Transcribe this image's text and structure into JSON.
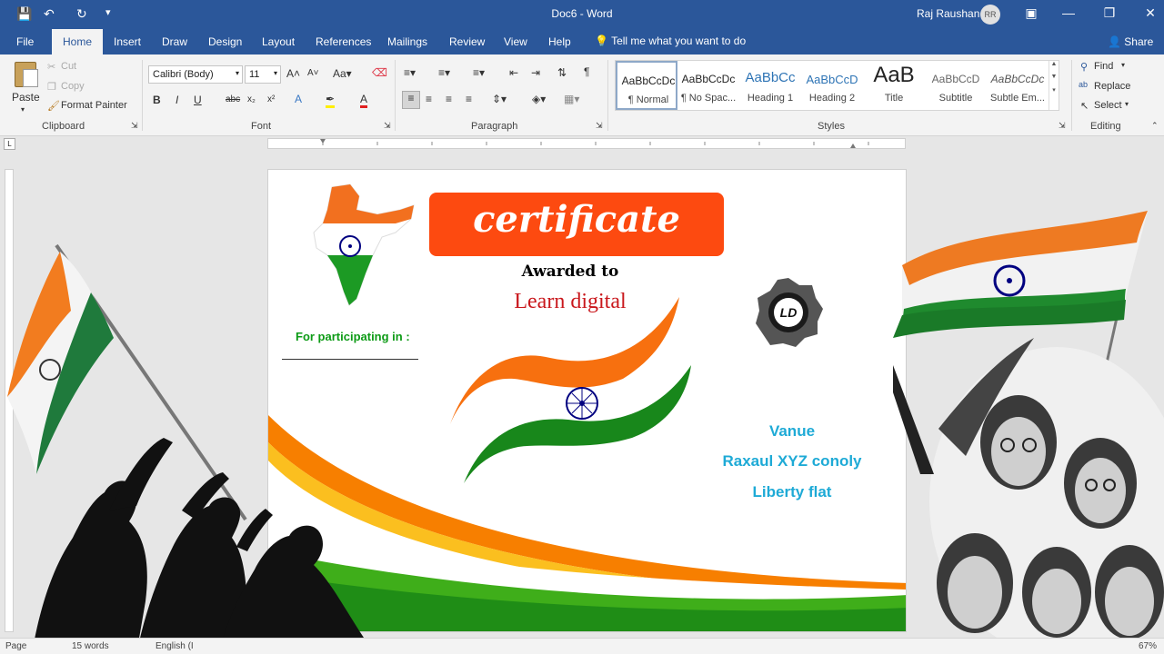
{
  "window": {
    "title": "Doc6  -  Word",
    "user_name": "Raj Raushan",
    "user_initials": "RR"
  },
  "menu_tabs": [
    "File",
    "Home",
    "Insert",
    "Draw",
    "Design",
    "Layout",
    "References",
    "Mailings",
    "Review",
    "View",
    "Help"
  ],
  "active_tab": "Home",
  "tell_me": "Tell me what you want to do",
  "share_label": "Share",
  "clipboard": {
    "paste": "Paste",
    "cut": "Cut",
    "copy": "Copy",
    "format_painter": "Format Painter",
    "group_label": "Clipboard"
  },
  "font": {
    "family": "Calibri (Body)",
    "size": "11",
    "group_label": "Font"
  },
  "paragraph": {
    "group_label": "Paragraph"
  },
  "styles": {
    "group_label": "Styles",
    "items": [
      {
        "sample": "AaBbCcDc",
        "name": "¶ Normal"
      },
      {
        "sample": "AaBbCcDc",
        "name": "¶ No Spac..."
      },
      {
        "sample": "AaBbCc",
        "name": "Heading 1"
      },
      {
        "sample": "AaBbCcD",
        "name": "Heading 2"
      },
      {
        "sample": "AaB",
        "name": "Title"
      },
      {
        "sample": "AaBbCcD",
        "name": "Subtitle"
      },
      {
        "sample": "AaBbCcDc",
        "name": "Subtle Em..."
      }
    ]
  },
  "editing": {
    "find": "Find",
    "replace": "Replace",
    "select": "Select",
    "group_label": "Editing"
  },
  "certificate": {
    "title": "certificate",
    "awarded_to": "Awarded to",
    "recipient": "Learn digital",
    "participating": "For participating in :",
    "venue_lines": [
      "Vanue",
      "Raxaul XYZ conoly",
      "Liberty flat"
    ],
    "logo_text": "LD"
  },
  "status": {
    "page": "Page",
    "words": "15 words",
    "language": "English (I",
    "zoom": "67%"
  },
  "colors": {
    "word_blue": "#2b579a",
    "saffron": "#fd6a0f",
    "india_green": "#138808",
    "navy": "#000080",
    "venue_blue": "#1eaad6",
    "recipient_red": "#c9171c"
  }
}
